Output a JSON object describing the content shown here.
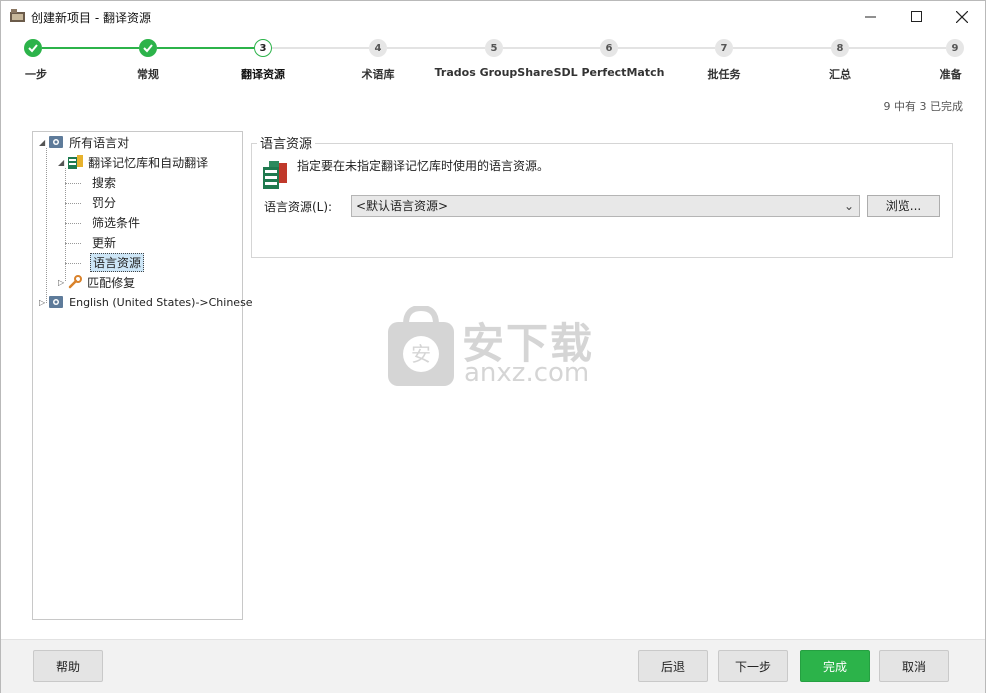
{
  "window": {
    "title": "创建新项目 - 翻译资源"
  },
  "stepper": {
    "steps": [
      {
        "number": "1",
        "label": "一步",
        "state": "done"
      },
      {
        "number": "2",
        "label": "常规",
        "state": "done"
      },
      {
        "number": "3",
        "label": "翻译资源",
        "state": "current"
      },
      {
        "number": "4",
        "label": "术语库",
        "state": "todo"
      },
      {
        "number": "5",
        "label": "Trados GroupShare",
        "state": "todo"
      },
      {
        "number": "6",
        "label": "SDL PerfectMatch",
        "state": "todo"
      },
      {
        "number": "7",
        "label": "批任务",
        "state": "todo"
      },
      {
        "number": "8",
        "label": "汇总",
        "state": "todo"
      },
      {
        "number": "9",
        "label": "准备",
        "state": "todo"
      }
    ],
    "progress_text": "9 中有 3 已完成"
  },
  "tree": {
    "root": "所有语言对",
    "tm_node": "翻译记忆库和自动翻译",
    "children": [
      "搜索",
      "罚分",
      "筛选条件",
      "更新",
      "语言资源"
    ],
    "match_repair": "匹配修复",
    "language_pair": "English (United States)->Chinese"
  },
  "panel": {
    "group_title": "语言资源",
    "description": "指定要在未指定翻译记忆库时使用的语言资源。",
    "field_label": "语言资源(L):",
    "select_value": "<默认语言资源>",
    "browse_label": "浏览..."
  },
  "watermark": {
    "text": "安下载",
    "url": "anxz.com",
    "badge": "安"
  },
  "footer": {
    "help": "帮助",
    "back": "后退",
    "next": "下一步",
    "finish": "完成",
    "cancel": "取消"
  },
  "colors": {
    "accent": "#2cb34a",
    "selection": "#cde6f7"
  }
}
